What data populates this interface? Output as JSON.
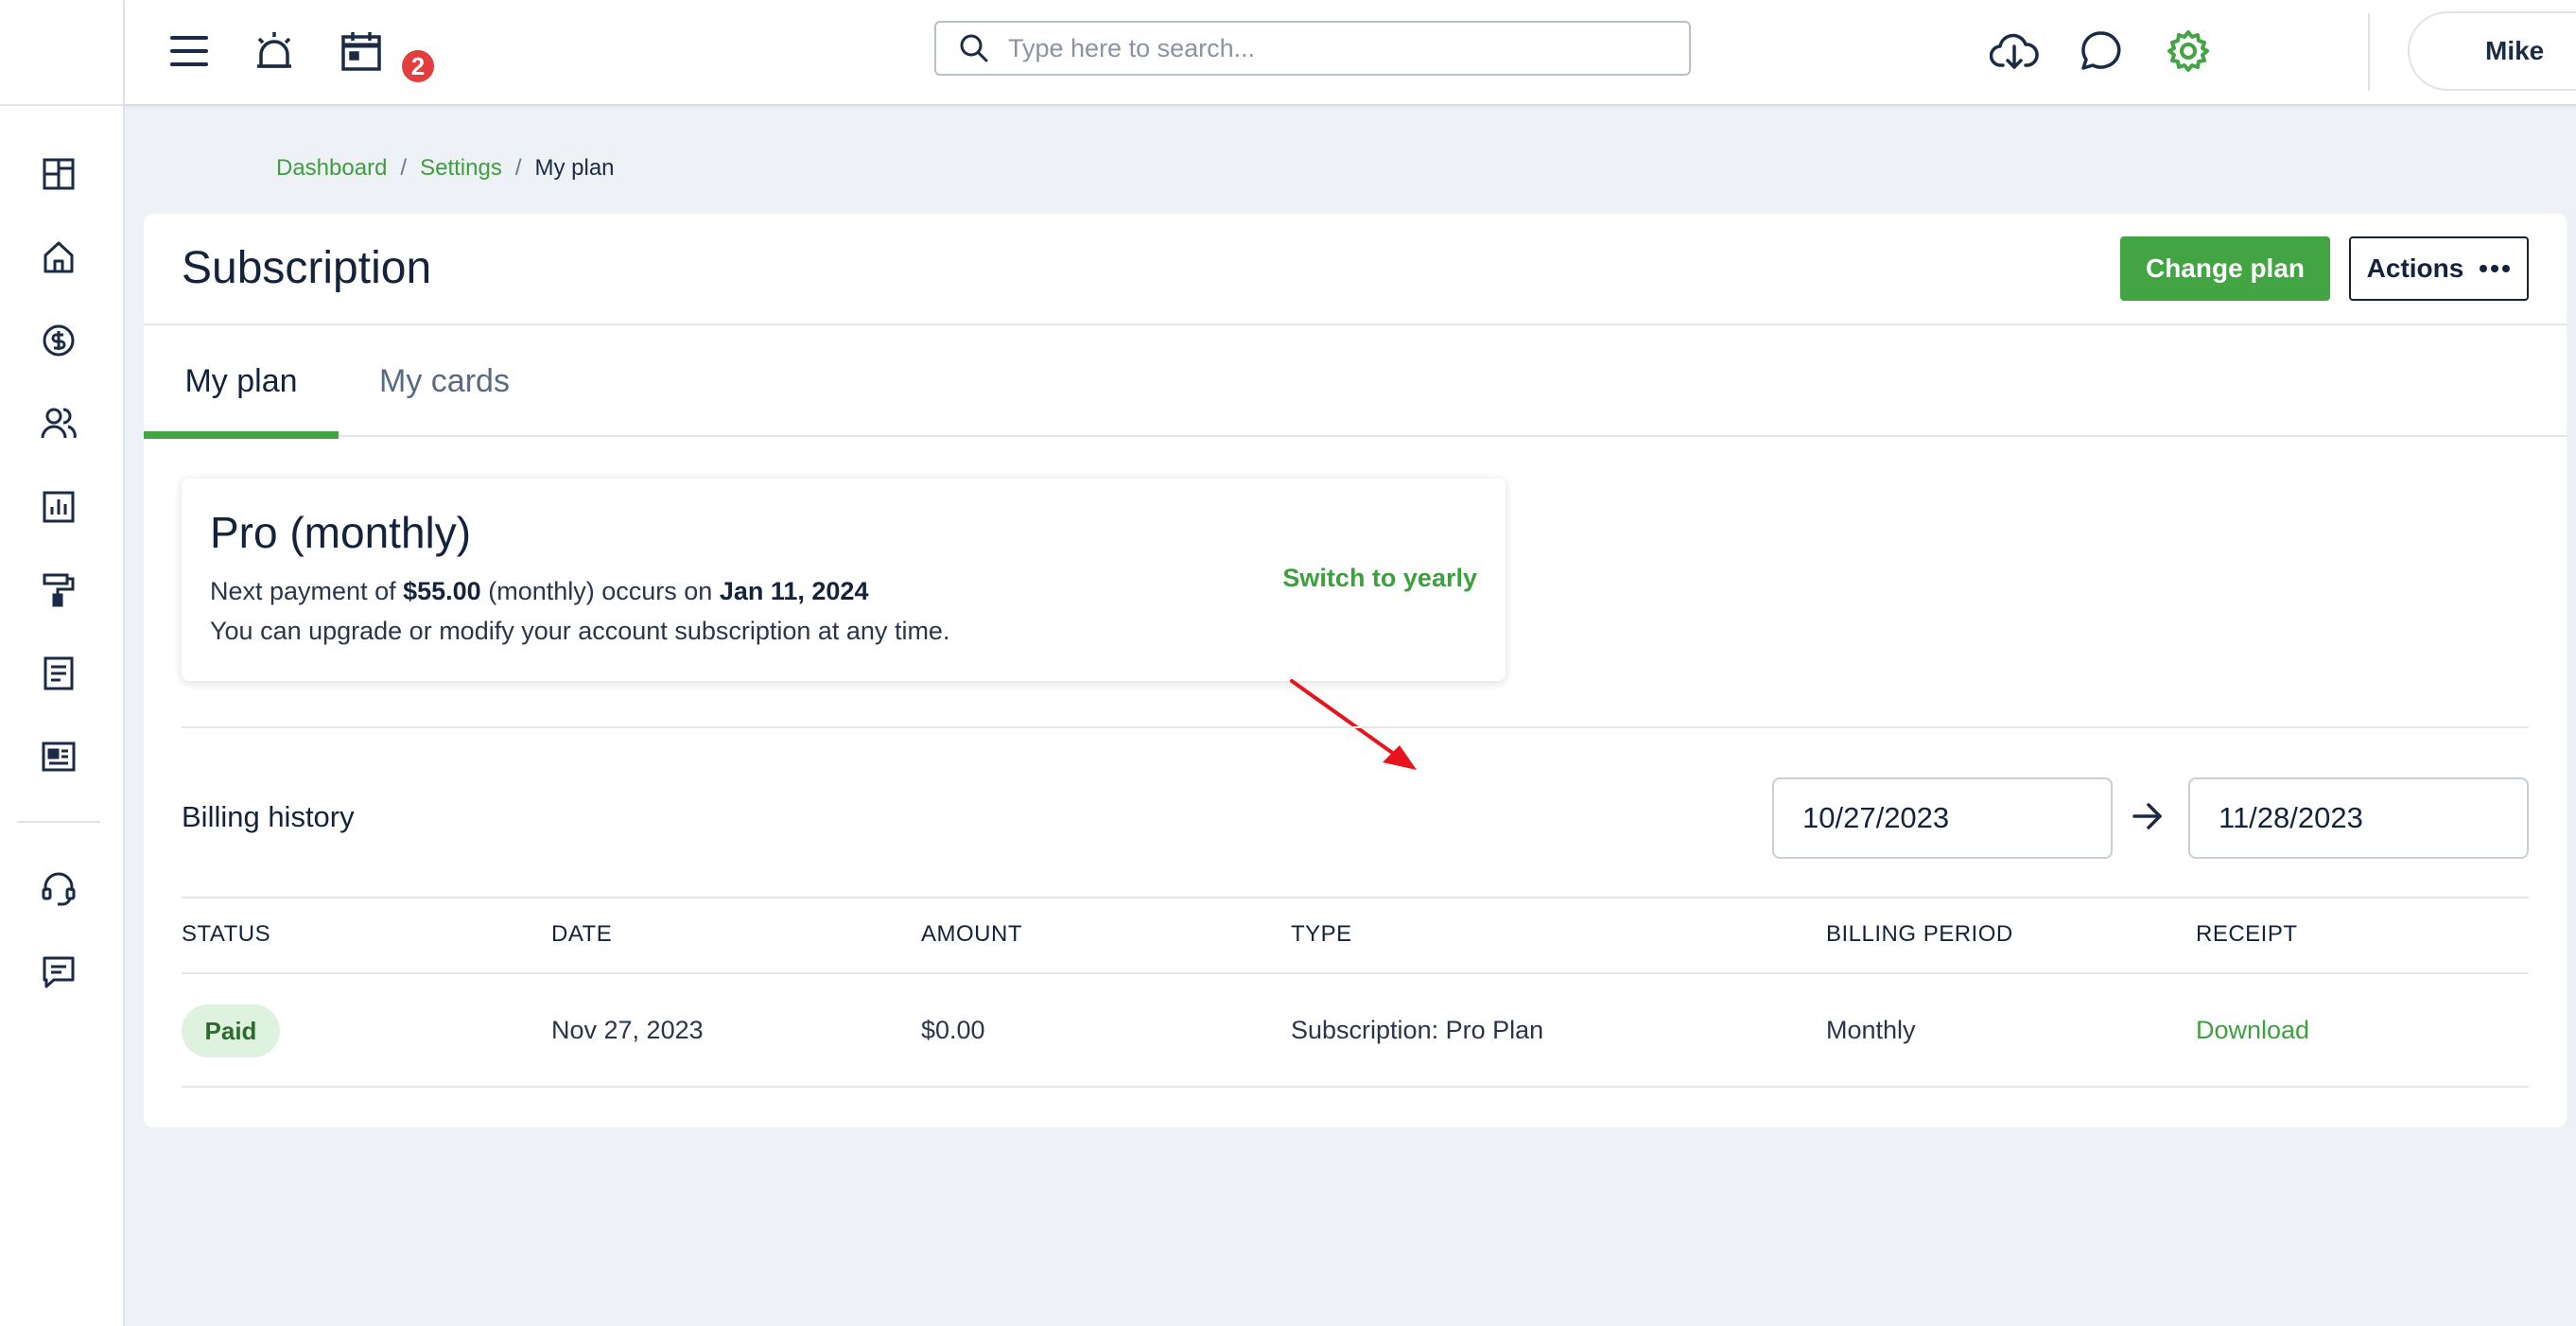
{
  "header": {
    "notifications_count": "2",
    "search_placeholder": "Type here to search...",
    "user_name": "Mike"
  },
  "icons": {
    "menu": "hamburger-icon",
    "alarm": "alarm-icon",
    "calendar": "calendar-icon",
    "cloud_download": "cloud-download-icon",
    "chat": "chat-bubble-icon",
    "settings": "gear-icon",
    "sidebar": [
      "dashboard-grid-icon",
      "home-icon",
      "dollar-icon",
      "users-icon",
      "chart-icon",
      "paint-roller-icon",
      "document-icon",
      "newspaper-icon",
      "headset-icon",
      "message-icon"
    ]
  },
  "breadcrumb": {
    "items": [
      "Dashboard",
      "Settings"
    ],
    "separator": "/",
    "current": "My plan"
  },
  "page": {
    "title": "Subscription",
    "change_plan_label": "Change plan",
    "actions_label": "Actions"
  },
  "tabs": [
    {
      "label": "My plan",
      "active": true
    },
    {
      "label": "My cards",
      "active": false
    }
  ],
  "plan": {
    "name": "Pro (monthly)",
    "next_payment_prefix": "Next payment of",
    "amount": "$55.00",
    "period_text": "(monthly) occurs on",
    "date": "Jan 11, 2024",
    "description": "You can upgrade or modify your account subscription at any time.",
    "switch_label": "Switch to yearly"
  },
  "billing": {
    "title": "Billing history",
    "date_from": "10/27/2023",
    "date_to": "11/28/2023",
    "columns": [
      "STATUS",
      "DATE",
      "AMOUNT",
      "TYPE",
      "BILLING PERIOD",
      "RECEIPT"
    ],
    "rows": [
      {
        "status": "Paid",
        "date": "Nov 27, 2023",
        "amount": "$0.00",
        "type": "Subscription: Pro Plan",
        "period": "Monthly",
        "receipt": "Download"
      }
    ]
  },
  "colors": {
    "accent": "#42a442",
    "danger": "#e23e3e",
    "text_dark": "#14233b",
    "annotation_arrow": "#e8141c"
  }
}
